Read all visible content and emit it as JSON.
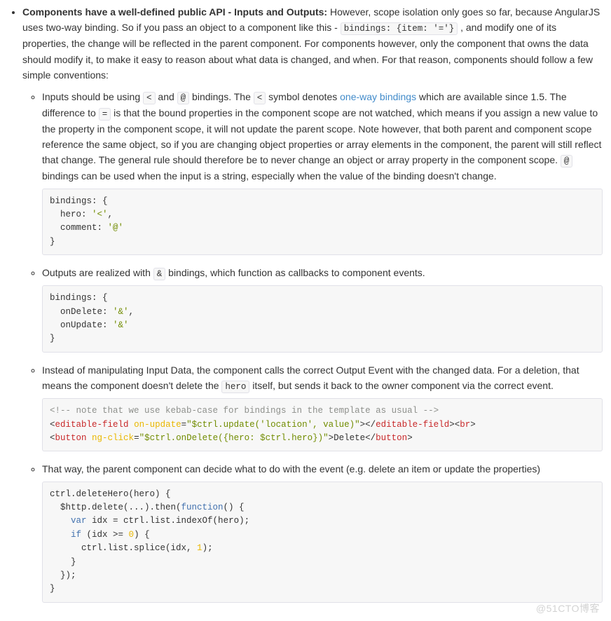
{
  "main": {
    "lead_bold": "Components have a well-defined public API - Inputs and Outputs:",
    "lead_rest_1": " However, scope isolation only goes so far, because AngularJS uses two-way binding. So if you pass an object to a component like this - ",
    "lead_code": "bindings: {item: '='}",
    "lead_rest_2": " , and modify one of its properties, the change will be reflected in the parent component. For components however, only the component that owns the data should modify it, to make it easy to reason about what data is changed, and when. For that reason, components should follow a few simple conventions:"
  },
  "items": {
    "inputs": {
      "t1": "Inputs should be using ",
      "sym_lt": "<",
      "t2": " and ",
      "sym_at": "@",
      "t3": " bindings. The ",
      "sym_lt2": "<",
      "t4": " symbol denotes ",
      "link_text": "one-way bindings",
      "t5": " which are available since 1.5. The difference to ",
      "sym_eq": "=",
      "t6": " is that the bound properties in the component scope are not watched, which means if you assign a new value to the property in the component scope, it will not update the parent scope. Note however, that both parent and component scope reference the same object, so if you are changing object properties or array elements in the component, the parent will still reflect that change. The general rule should therefore be to never change an object or array property in the component scope. ",
      "sym_at2": "@",
      "t7": " bindings can be used when the input is a string, especially when the value of the binding doesn't change."
    },
    "outputs": {
      "t1": "Outputs are realized with ",
      "sym_amp": "&",
      "t2": " bindings, which function as callbacks to component events."
    },
    "instead": {
      "t1": "Instead of manipulating Input Data, the component calls the correct Output Event with the changed data. For a deletion, that means the component doesn't delete the ",
      "hero_code": "hero",
      "t2": " itself, but sends it back to the owner component via the correct event."
    },
    "thatway": {
      "t1": "That way, the parent component can decide what to do with the event (e.g. delete an item or update the properties)"
    }
  },
  "code": {
    "inputs": {
      "l1": "bindings: {",
      "l2a": "  hero: ",
      "l2b": "'<'",
      "l2c": ",",
      "l3a": "  comment: ",
      "l3b": "'@'",
      "l4": "}"
    },
    "outputs": {
      "l1": "bindings: {",
      "l2a": "  onDelete: ",
      "l2b": "'&'",
      "l2c": ",",
      "l3a": "  onUpdate: ",
      "l3b": "'&'",
      "l4": "}"
    },
    "template": {
      "cmt": "<!-- note that we use kebab-case for bindings in the template as usual -->",
      "l2_open1": "<",
      "l2_tag1": "editable-field",
      "l2_sp": " ",
      "l2_attr": "on-update",
      "l2_eq": "=",
      "l2_val": "\"$ctrl.update('location', value)\"",
      "l2_close1": ">",
      "l2_open2": "</",
      "l2_tag1b": "editable-field",
      "l2_close2": "><",
      "l2_br": "br",
      "l2_close3": ">",
      "l3_open": "<",
      "l3_tag": "button",
      "l3_sp": " ",
      "l3_attr": "ng-click",
      "l3_eq": "=",
      "l3_val": "\"$ctrl.onDelete({hero: $ctrl.hero})\"",
      "l3_close": ">",
      "l3_text": "Delete",
      "l3_open2": "</",
      "l3_tag2": "button",
      "l3_close2": ">"
    },
    "ctrl": {
      "l1": "ctrl.deleteHero(hero) {",
      "l2a": "  $http.delete(...).then(",
      "l2b": "function",
      "l2c": "() {",
      "l3a": "    ",
      "l3b": "var",
      "l3c": " idx = ctrl.list.indexOf(hero);",
      "l4a": "    ",
      "l4b": "if",
      "l4c": " (idx >= ",
      "l4d": "0",
      "l4e": ") {",
      "l5a": "      ctrl.list.splice(idx, ",
      "l5b": "1",
      "l5c": ");",
      "l6": "    }",
      "l7": "  });",
      "l8": "}"
    }
  },
  "watermark": "@51CTO博客"
}
